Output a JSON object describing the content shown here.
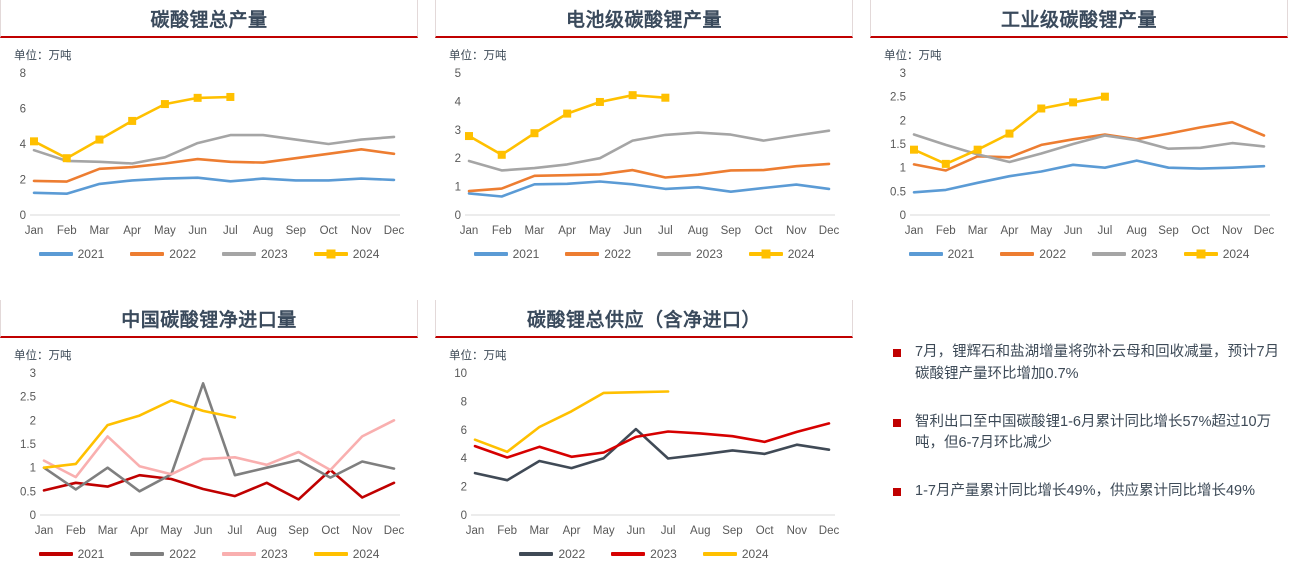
{
  "unit_label": "单位：万吨",
  "colors": {
    "accent_red": "#C00000",
    "title_text": "#3A4A5C",
    "blue_2021": "#5B9BD5",
    "orange_2022": "#ED7D31",
    "gray_2023": "#A5A5A5",
    "yellow_2024": "#FFC000",
    "darkred_2021": "#C00000",
    "darkgray_2022": "#7F7F7F",
    "pink_2023": "#F9AFAF",
    "slate_2022": "#404A56",
    "red_2023": "#D60000"
  },
  "months": [
    "Jan",
    "Feb",
    "Mar",
    "Apr",
    "May",
    "Jun",
    "Jul",
    "Aug",
    "Sep",
    "Oct",
    "Nov",
    "Dec"
  ],
  "charts": [
    {
      "id": "total-lithium-carbonate-output",
      "title": "碳酸锂总产量",
      "unit": "单位：万吨",
      "chart_data": {
        "type": "line",
        "title": "碳酸锂总产量",
        "xlabel": "",
        "ylabel": "万吨",
        "ylim": [
          0,
          8
        ],
        "yticks": [
          0,
          2,
          4,
          6,
          8
        ],
        "grid": false,
        "legend": "bottom",
        "categories": [
          "Jan",
          "Feb",
          "Mar",
          "Apr",
          "May",
          "Jun",
          "Jul",
          "Aug",
          "Sep",
          "Oct",
          "Nov",
          "Dec"
        ],
        "series": [
          {
            "name": "2021",
            "color": "#5B9BD5",
            "markers": false,
            "values": [
              1.25,
              1.2,
              1.75,
              1.95,
              2.05,
              2.1,
              1.9,
              2.05,
              1.95,
              1.95,
              2.05,
              1.98
            ]
          },
          {
            "name": "2022",
            "color": "#ED7D31",
            "markers": false,
            "values": [
              1.92,
              1.88,
              2.6,
              2.7,
              2.9,
              3.15,
              3.0,
              2.95,
              3.2,
              3.45,
              3.7,
              3.45
            ]
          },
          {
            "name": "2023",
            "color": "#A5A5A5",
            "markers": false,
            "values": [
              3.65,
              3.05,
              3.0,
              2.9,
              3.25,
              4.05,
              4.5,
              4.5,
              4.25,
              4.0,
              4.25,
              4.4
            ]
          },
          {
            "name": "2024",
            "color": "#FFC000",
            "markers": true,
            "values": [
              4.15,
              3.2,
              4.25,
              5.3,
              6.25,
              6.6,
              6.65,
              null,
              null,
              null,
              null,
              null
            ]
          }
        ]
      }
    },
    {
      "id": "battery-grade-output",
      "title": "电池级碳酸锂产量",
      "unit": "单位：万吨",
      "chart_data": {
        "type": "line",
        "title": "电池级碳酸锂产量",
        "xlabel": "",
        "ylabel": "万吨",
        "ylim": [
          0,
          5
        ],
        "yticks": [
          0,
          1,
          2,
          3,
          4,
          5
        ],
        "grid": false,
        "legend": "bottom",
        "categories": [
          "Jan",
          "Feb",
          "Mar",
          "Apr",
          "May",
          "Jun",
          "Jul",
          "Aug",
          "Sep",
          "Oct",
          "Nov",
          "Dec"
        ],
        "series": [
          {
            "name": "2021",
            "color": "#5B9BD5",
            "markers": false,
            "values": [
              0.76,
              0.65,
              1.08,
              1.1,
              1.18,
              1.08,
              0.92,
              0.98,
              0.82,
              0.95,
              1.07,
              0.92
            ]
          },
          {
            "name": "2022",
            "color": "#ED7D31",
            "markers": false,
            "values": [
              0.84,
              0.93,
              1.38,
              1.4,
              1.43,
              1.58,
              1.32,
              1.42,
              1.57,
              1.58,
              1.72,
              1.8
            ]
          },
          {
            "name": "2023",
            "color": "#A5A5A5",
            "markers": false,
            "values": [
              1.9,
              1.57,
              1.65,
              1.78,
              2.0,
              2.62,
              2.82,
              2.9,
              2.83,
              2.62,
              2.8,
              2.97
            ]
          },
          {
            "name": "2024",
            "color": "#FFC000",
            "markers": true,
            "values": [
              2.78,
              2.12,
              2.88,
              3.57,
              3.98,
              4.22,
              4.13,
              null,
              null,
              null,
              null,
              null
            ]
          }
        ]
      }
    },
    {
      "id": "industrial-grade-output",
      "title": "工业级碳酸锂产量",
      "unit": "单位：万吨",
      "chart_data": {
        "type": "line",
        "title": "工业级碳酸锂产量",
        "xlabel": "",
        "ylabel": "万吨",
        "ylim": [
          0,
          3
        ],
        "yticks": [
          0,
          0.5,
          1,
          1.5,
          2,
          2.5,
          3
        ],
        "grid": false,
        "legend": "bottom",
        "categories": [
          "Jan",
          "Feb",
          "Mar",
          "Apr",
          "May",
          "Jun",
          "Jul",
          "Aug",
          "Sep",
          "Oct",
          "Nov",
          "Dec"
        ],
        "series": [
          {
            "name": "2021",
            "color": "#5B9BD5",
            "markers": false,
            "values": [
              0.48,
              0.53,
              0.68,
              0.82,
              0.92,
              1.06,
              1.0,
              1.15,
              1.0,
              0.98,
              1.0,
              1.03
            ]
          },
          {
            "name": "2022",
            "color": "#ED7D31",
            "markers": false,
            "values": [
              1.07,
              0.94,
              1.24,
              1.22,
              1.48,
              1.6,
              1.7,
              1.6,
              1.72,
              1.85,
              1.96,
              1.68
            ]
          },
          {
            "name": "2023",
            "color": "#A5A5A5",
            "markers": false,
            "values": [
              1.7,
              1.48,
              1.28,
              1.12,
              1.3,
              1.5,
              1.68,
              1.58,
              1.4,
              1.42,
              1.52,
              1.45
            ]
          },
          {
            "name": "2024",
            "color": "#FFC000",
            "markers": true,
            "values": [
              1.38,
              1.08,
              1.38,
              1.72,
              2.25,
              2.38,
              2.5,
              null,
              null,
              null,
              null,
              null
            ]
          }
        ]
      }
    },
    {
      "id": "china-net-imports",
      "title": "中国碳酸锂净进口量",
      "unit": "单位：万吨",
      "chart_data": {
        "type": "line",
        "title": "中国碳酸锂净进口量",
        "xlabel": "",
        "ylabel": "万吨",
        "ylim": [
          0,
          3
        ],
        "yticks": [
          0,
          0.5,
          1,
          1.5,
          2,
          2.5,
          3
        ],
        "grid": false,
        "legend": "bottom",
        "categories": [
          "Jan",
          "Feb",
          "Mar",
          "Apr",
          "May",
          "Jun",
          "Jul",
          "Aug",
          "Sep",
          "Oct",
          "Nov",
          "Dec"
        ],
        "series": [
          {
            "name": "2021",
            "color": "#C00000",
            "markers": false,
            "values": [
              0.52,
              0.68,
              0.6,
              0.84,
              0.76,
              0.55,
              0.4,
              0.68,
              0.33,
              0.95,
              0.37,
              0.68
            ]
          },
          {
            "name": "2022",
            "color": "#7F7F7F",
            "markers": false,
            "values": [
              1.0,
              0.54,
              1.0,
              0.5,
              0.86,
              2.78,
              0.84,
              1.0,
              1.16,
              0.79,
              1.13,
              0.98
            ]
          },
          {
            "name": "2023",
            "color": "#F9AFAF",
            "markers": false,
            "values": [
              1.15,
              0.8,
              1.66,
              1.03,
              0.86,
              1.18,
              1.22,
              1.06,
              1.33,
              0.95,
              1.66,
              2.0
            ]
          },
          {
            "name": "2024",
            "color": "#FFC000",
            "markers": false,
            "values": [
              1.0,
              1.08,
              1.9,
              2.1,
              2.42,
              2.2,
              2.06,
              null,
              null,
              null,
              null,
              null
            ]
          }
        ]
      }
    },
    {
      "id": "total-supply-incl-net-imports",
      "title": "碳酸锂总供应（含净进口）",
      "unit": "单位：万吨",
      "chart_data": {
        "type": "line",
        "title": "碳酸锂总供应（含净进口）",
        "xlabel": "",
        "ylabel": "万吨",
        "ylim": [
          0,
          10
        ],
        "yticks": [
          0,
          2,
          4,
          6,
          8,
          10
        ],
        "grid": false,
        "legend": "bottom",
        "categories": [
          "Jan",
          "Feb",
          "Mar",
          "Apr",
          "May",
          "Jun",
          "Jul",
          "Aug",
          "Sep",
          "Oct",
          "Nov",
          "Dec"
        ],
        "series": [
          {
            "name": "2022",
            "color": "#404A56",
            "markers": false,
            "values": [
              2.95,
              2.45,
              3.8,
              3.3,
              4.0,
              6.05,
              3.98,
              4.25,
              4.55,
              4.3,
              4.95,
              4.6
            ]
          },
          {
            "name": "2023",
            "color": "#D60000",
            "markers": false,
            "values": [
              4.85,
              4.05,
              4.8,
              4.1,
              4.4,
              5.5,
              5.88,
              5.75,
              5.55,
              5.15,
              5.85,
              6.45
            ]
          },
          {
            "name": "2024",
            "color": "#FFC000",
            "markers": false,
            "values": [
              5.3,
              4.45,
              6.2,
              7.3,
              8.6,
              8.65,
              8.7,
              null,
              null,
              null,
              null,
              null
            ]
          }
        ]
      }
    }
  ],
  "bullets": [
    "7月，锂辉石和盐湖增量将弥补云母和回收减量，预计7月碳酸锂产量环比增加0.7%",
    "智利出口至中国碳酸锂1-6月累计同比增长57%超过10万吨，但6-7月环比减少",
    "1-7月产量累计同比增长49%，供应累计同比增长49%"
  ]
}
